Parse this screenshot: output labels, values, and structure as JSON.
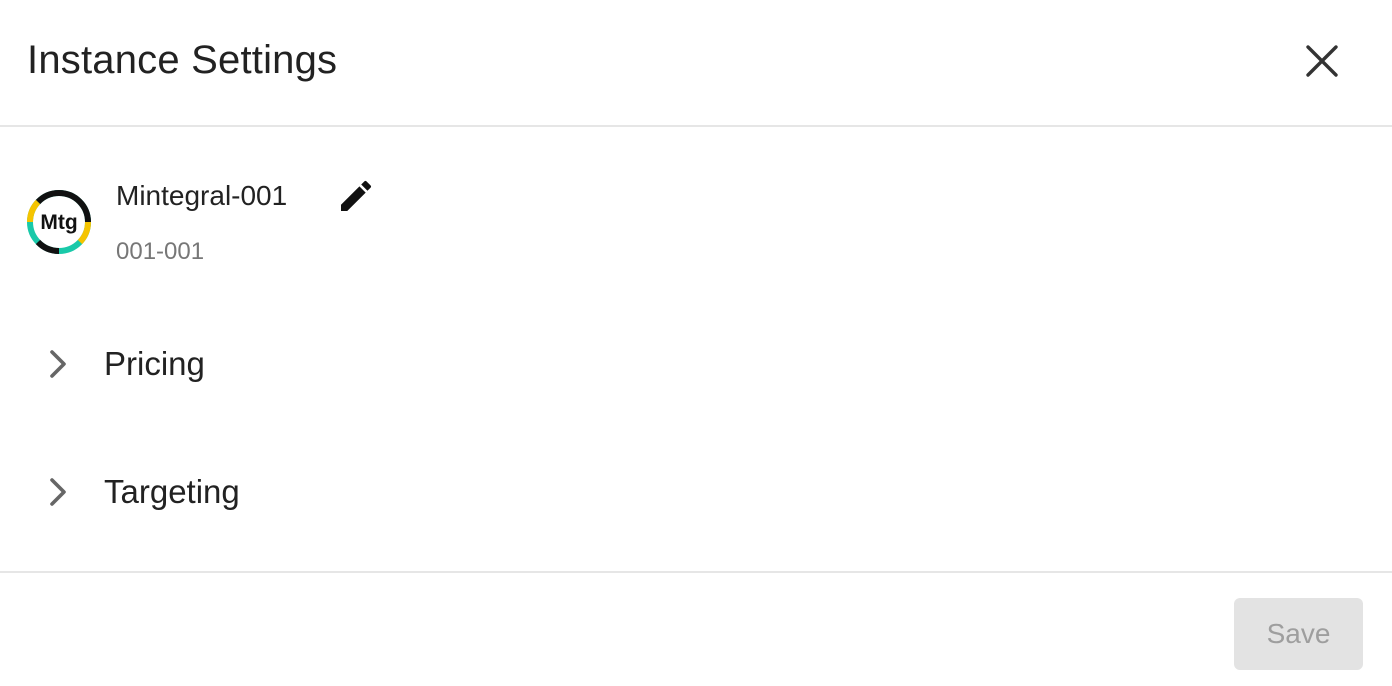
{
  "dialog": {
    "title": "Instance Settings",
    "close_icon": "close-icon"
  },
  "instance": {
    "logo_text": "Mtg",
    "name": "Mintegral-001",
    "id": "001-001",
    "edit_icon": "pencil-icon"
  },
  "sections": [
    {
      "label": "Pricing",
      "icon": "chevron-right-icon",
      "expanded": false
    },
    {
      "label": "Targeting",
      "icon": "chevron-right-icon",
      "expanded": false
    }
  ],
  "footer": {
    "save_label": "Save",
    "save_enabled": false
  },
  "colors": {
    "logo_teal": "#19c9a9",
    "logo_yellow": "#f5c400",
    "logo_black": "#111111",
    "divider": "#e6e6e6",
    "save_bg_disabled": "#e3e3e3",
    "save_text_disabled": "#9e9e9e"
  }
}
